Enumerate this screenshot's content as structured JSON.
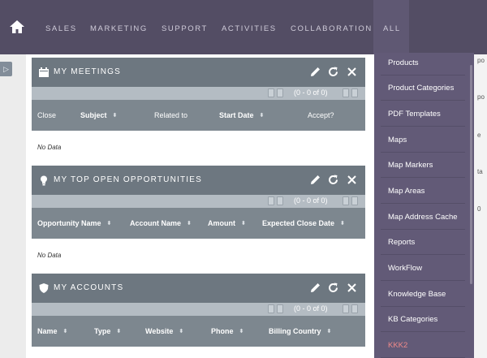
{
  "nav": {
    "items": [
      "SALES",
      "MARKETING",
      "SUPPORT",
      "ACTIVITIES",
      "COLLABORATION"
    ],
    "all_label": "ALL"
  },
  "menu": {
    "items": [
      "Products",
      "Product Categories",
      "PDF Templates",
      "Maps",
      "Map Markers",
      "Map Areas",
      "Map Address Cache",
      "Reports",
      "WorkFlow",
      "Knowledge Base",
      "KB Categories",
      "KKK2"
    ]
  },
  "dashlets": [
    {
      "title": "MY MEETINGS",
      "icon": "calendar-icon",
      "pagination": "(0 - 0 of 0)",
      "columns": [
        "Close",
        "Subject",
        "Related to",
        "Start Date",
        "Accept?"
      ],
      "empty": "No Data"
    },
    {
      "title": "MY TOP OPEN OPPORTUNITIES",
      "icon": "lightbulb-icon",
      "pagination": "(0 - 0 of 0)",
      "columns": [
        "Opportunity Name",
        "Account Name",
        "Amount",
        "Expected Close Date"
      ],
      "empty": "No Data"
    },
    {
      "title": "MY ACCOUNTS",
      "icon": "shield-icon",
      "pagination": "(0 - 0 of 0)",
      "columns": [
        "Name",
        "Type",
        "Website",
        "Phone",
        "Billing Country"
      ]
    }
  ],
  "background": {
    "fragments": [
      "po",
      "po",
      "e",
      "ta",
      "0"
    ]
  },
  "colors": {
    "navbar": "#534d64",
    "dropdown": "#625a77",
    "dashlet_header": "#6d7780",
    "column_header": "#7d878f",
    "pagination_bar": "#b4bcc3",
    "highlight": "#f08a8a"
  }
}
